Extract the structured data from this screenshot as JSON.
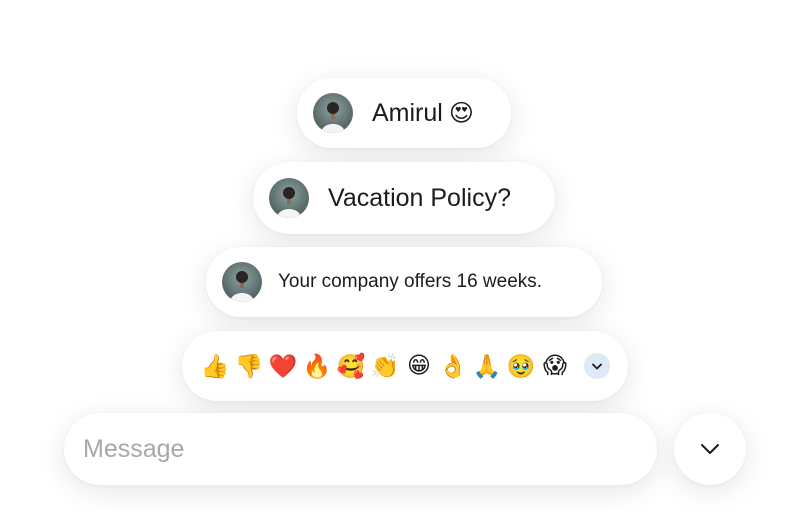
{
  "messages": [
    {
      "text": "Amirul",
      "emoji": "😍"
    },
    {
      "text": "Vacation Policy?"
    },
    {
      "text": "Your company offers 16 weeks."
    }
  ],
  "reactions": [
    "👍",
    "👎",
    "❤️",
    "🔥",
    "🥰",
    "👏",
    "😁",
    "👌",
    "🙏",
    "🥹",
    "😱"
  ],
  "composer": {
    "placeholder": "Message"
  },
  "icons": {
    "more_reactions": "chevron-down-icon",
    "expand": "chevron-down-icon",
    "avatar": "user-avatar"
  }
}
